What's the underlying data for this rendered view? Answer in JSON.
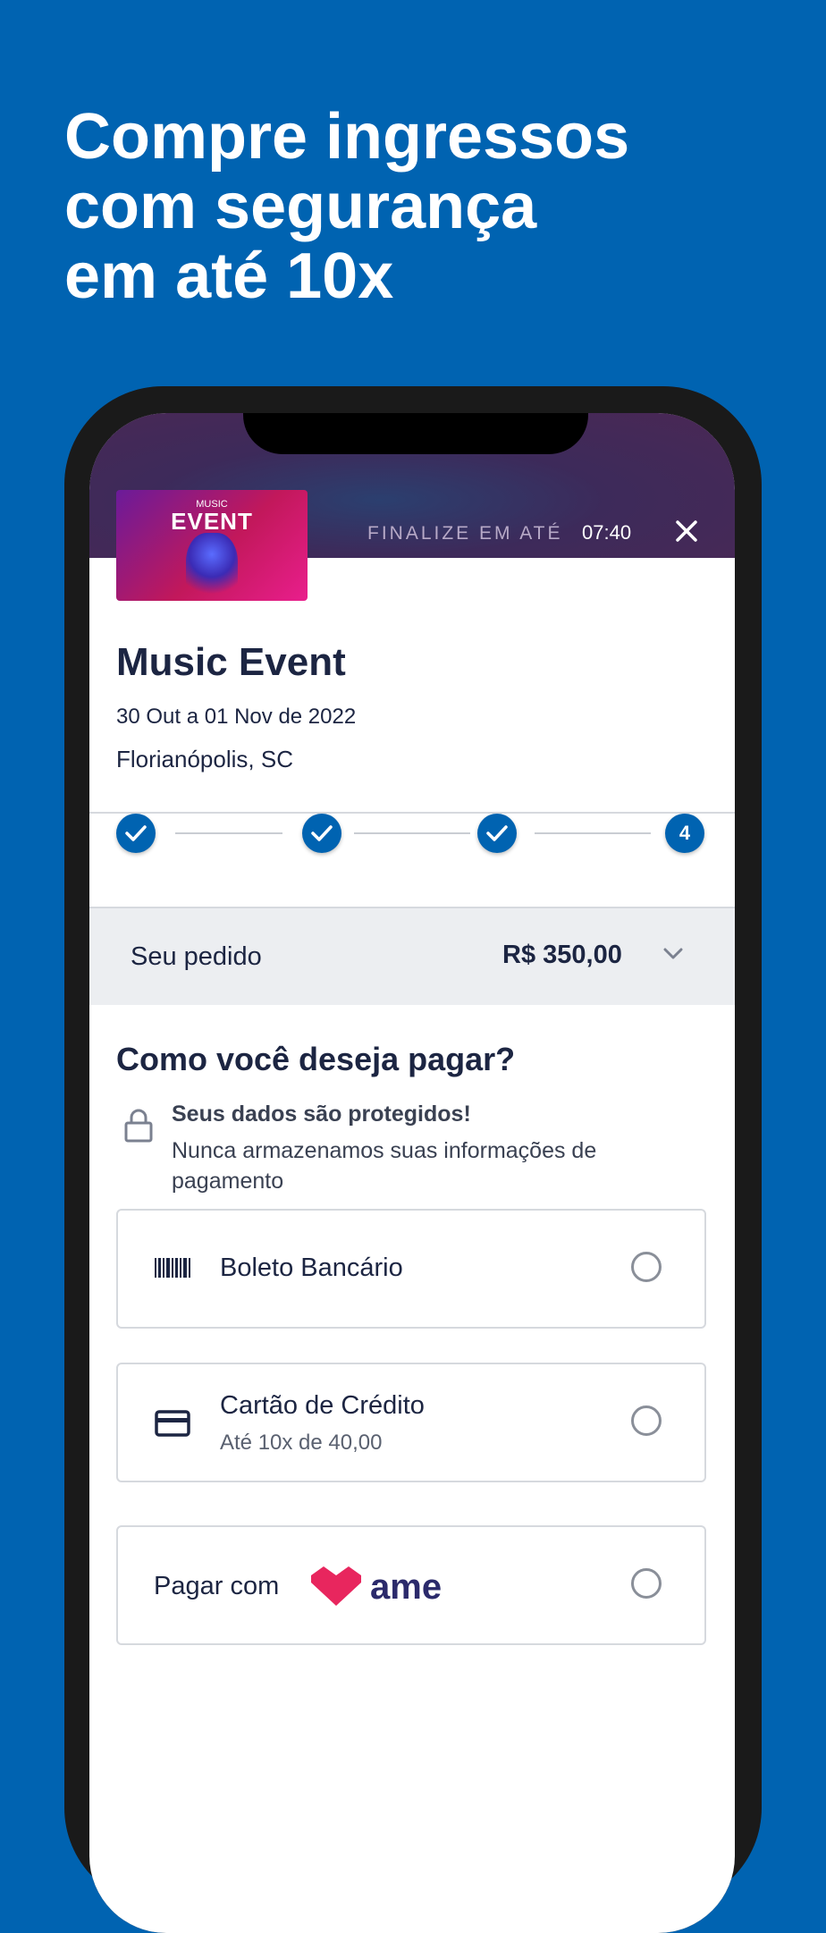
{
  "headline": {
    "line1": "Compre ingressos",
    "line2": "com segurança",
    "line3": "em até 10x"
  },
  "header": {
    "thumb_small": "MUSIC",
    "thumb_big": "EVENT",
    "timer_label": "FINALIZE EM ATÉ",
    "timer_value": "07:40",
    "close_icon": "close-icon"
  },
  "event": {
    "name": "Music Event",
    "date": "30 Out a 01 Nov de 2022",
    "place": "Florianópolis, SC"
  },
  "steps": [
    {
      "state": "done",
      "icon": "check-icon"
    },
    {
      "state": "done",
      "icon": "check-icon"
    },
    {
      "state": "done",
      "icon": "check-icon"
    },
    {
      "state": "current",
      "label": "4"
    }
  ],
  "order": {
    "label": "Seu pedido",
    "total": "R$ 350,00",
    "expand_icon": "chevron-down-icon"
  },
  "payment": {
    "title": "Como você deseja pagar?",
    "secure_title": "Seus dados são protegidos!",
    "secure_desc": "Nunca armazenamos suas informações de pagamento",
    "options": [
      {
        "label": "Boleto Bancário",
        "icon": "barcode-icon",
        "selected": false
      },
      {
        "label": "Cartão de Crédito",
        "sub": "Até 10x de 40,00",
        "icon": "credit-card-icon",
        "selected": false
      },
      {
        "label": "Pagar com",
        "brand": "ame",
        "icon": "ame-logo",
        "selected": false
      }
    ]
  },
  "colors": {
    "brand_blue": "#0063B1",
    "text_dark": "#1c2542",
    "ame_pink": "#E8265E",
    "ame_navy": "#2B2A6B"
  }
}
